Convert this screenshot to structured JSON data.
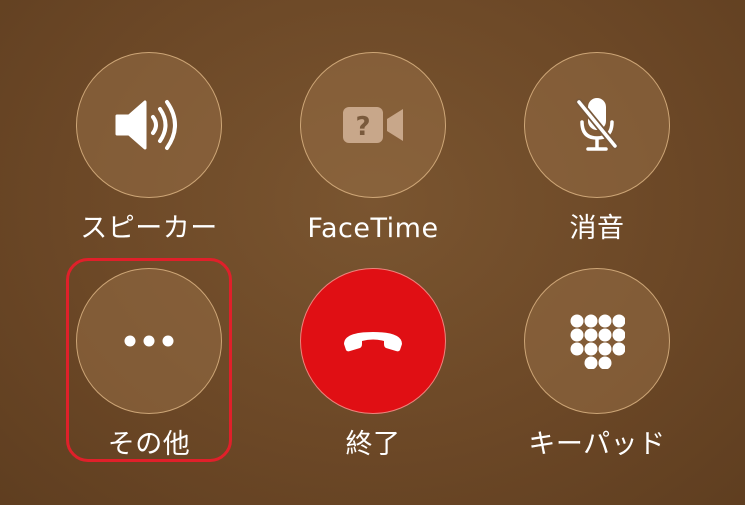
{
  "buttons": {
    "speaker": {
      "label": "スピーカー",
      "icon": "speaker-icon"
    },
    "facetime": {
      "label": "FaceTime",
      "icon": "facetime-question-icon"
    },
    "mute": {
      "label": "消音",
      "icon": "mic-off-icon"
    },
    "more": {
      "label": "その他",
      "icon": "ellipsis-icon"
    },
    "end": {
      "label": "終了",
      "icon": "phone-hangup-icon"
    },
    "keypad": {
      "label": "キーパッド",
      "icon": "keypad-icon"
    }
  },
  "colors": {
    "background": "#6b4726",
    "end_call": "#e00f14",
    "highlight": "#e0202a"
  }
}
